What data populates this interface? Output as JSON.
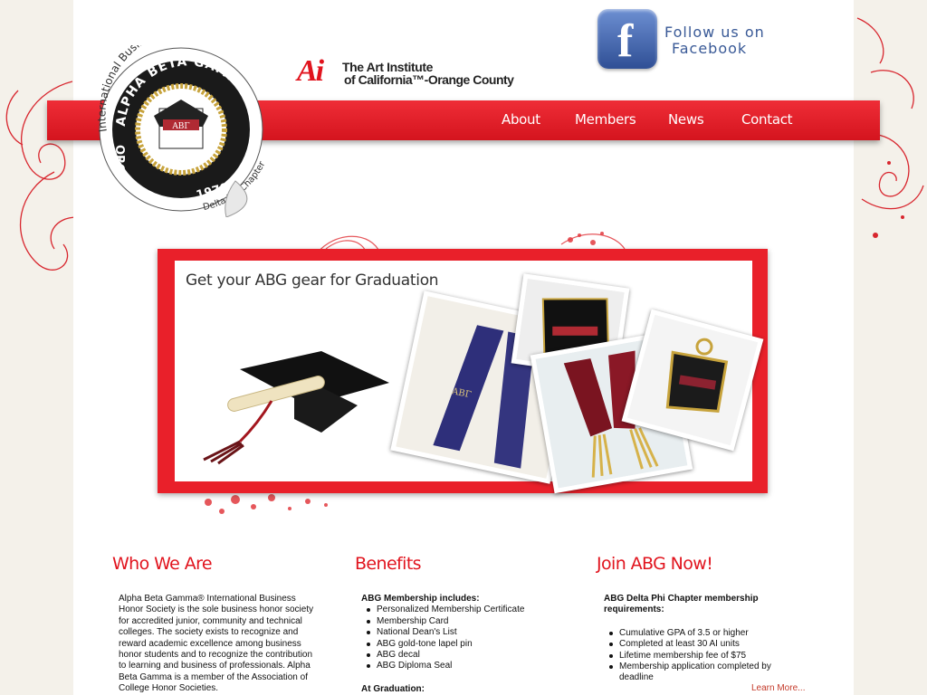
{
  "seal": {
    "outer_text": "International Business Honor Society",
    "inner_text": "ALPHA BETA GAMMA",
    "side_text": "ORG",
    "year": "1970",
    "greek": "ΑΒΓ",
    "chapter": "Delta Phi Chapter"
  },
  "ai_logo": {
    "mark": "Ai",
    "line1": "The Art Institute",
    "line2": "of California™-Orange County"
  },
  "facebook": {
    "line1": "Follow us on",
    "line2": "Facebook",
    "icon_letter": "f"
  },
  "nav": {
    "about": "About",
    "members": "Members",
    "news": "News",
    "contact": "Contact"
  },
  "banner": {
    "title": "Get your ABG gear for Graduation"
  },
  "who": {
    "title": "Who We Are",
    "text": "Alpha Beta Gamma® International Business Honor Society is the sole business honor society for accredited junior, community and technical colleges. The society exists to recognize and reward academic excellence among business honor students and to recognize the contribution to learning and business of professionals. Alpha Beta Gamma is a member of the Association of College Honor Societies."
  },
  "benefits": {
    "title": "Benefits",
    "heading": "ABG Membership includes:",
    "items": [
      "Personalized Membership Certificate",
      "Membership Card",
      "National Dean's List",
      "ABG gold-tone lapel pin",
      "ABG decal",
      "ABG Diploma Seal"
    ],
    "heading2": "At Graduation:"
  },
  "join": {
    "title": "Join ABG Now!",
    "heading": "ABG Delta Phi Chapter membership requirements:",
    "items": [
      "Cumulative GPA of 3.5 or higher",
      "Completed at least 30 AI units",
      "Lifetime membership fee of $75",
      "Membership application completed by deadline"
    ],
    "learn_more": "Learn More..."
  },
  "colors": {
    "accent_red": "#e1141e",
    "facebook_blue": "#3a5a97"
  }
}
